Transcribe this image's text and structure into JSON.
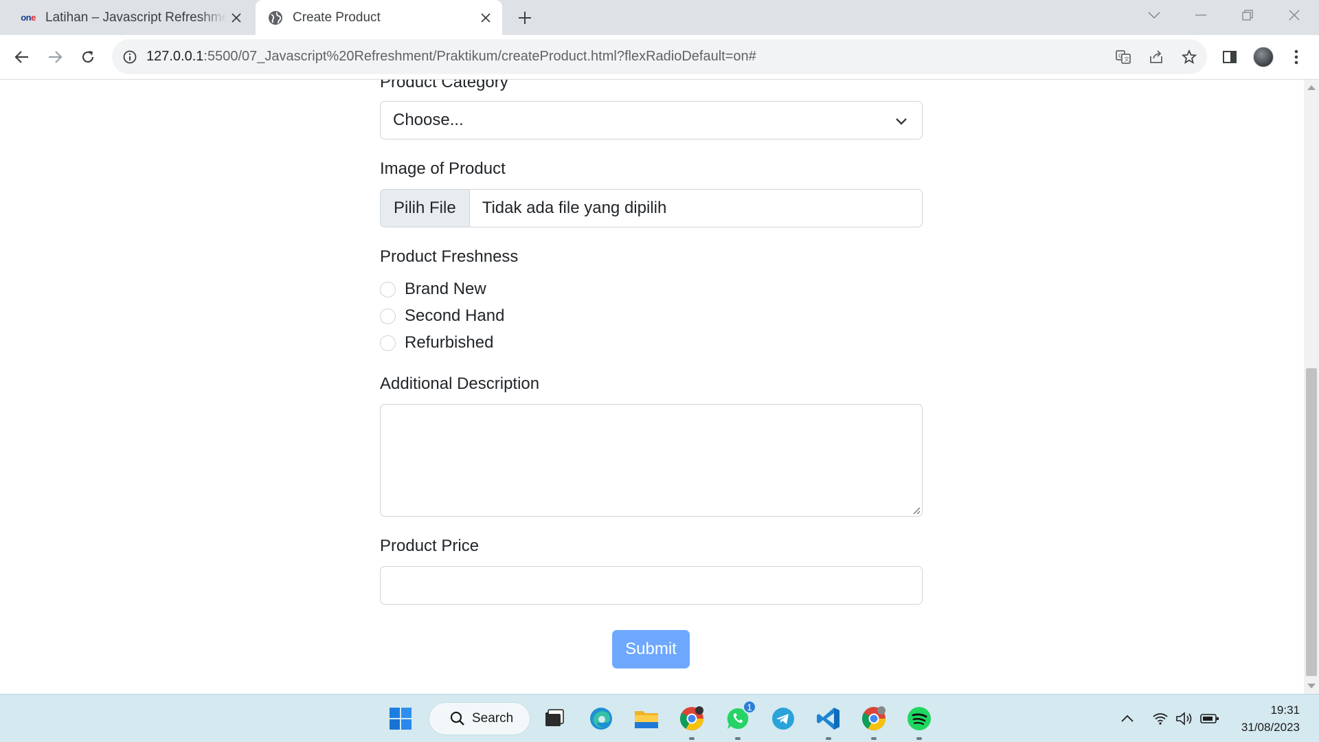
{
  "browser": {
    "tabs": [
      {
        "title": "Latihan – Javascript Refreshment",
        "favicon": "one-logo",
        "active": false
      },
      {
        "title": "Create Product",
        "favicon": "globe-icon",
        "active": true
      }
    ],
    "favicon_text": {
      "main": "on",
      "accent": "e"
    },
    "url": {
      "host": "127.0.0.1",
      "rest": ":5500/07_Javascript%20Refreshment/Praktikum/createProduct.html?flexRadioDefault=on#"
    }
  },
  "form": {
    "category_label": "Product Category",
    "category_value": "Choose...",
    "image_label": "Image of Product",
    "file_button": "Pilih File",
    "file_status": "Tidak ada file yang dipilih",
    "freshness_label": "Product Freshness",
    "freshness_options": [
      "Brand New",
      "Second Hand",
      "Refurbished"
    ],
    "description_label": "Additional Description",
    "price_label": "Product Price",
    "submit_label": "Submit"
  },
  "taskbar": {
    "search_label": "Search",
    "whatsapp_badge": "1",
    "time": "19:31",
    "date": "31/08/2023"
  },
  "colors": {
    "submit_bg": "#6ea8fe",
    "tabstrip_bg": "#dee1e6",
    "taskbar_bg": "#d4e9f0"
  }
}
